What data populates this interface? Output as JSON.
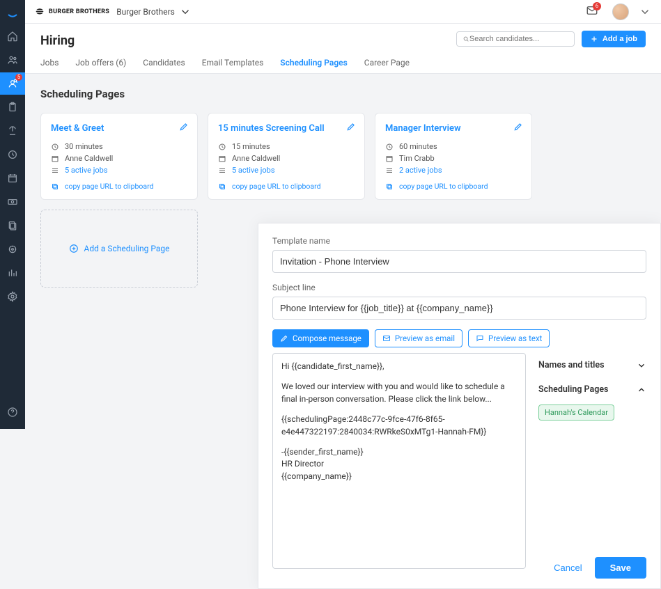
{
  "brand": {
    "logo_text": "BURGER BROTHERS",
    "company_name": "Burger Brothers"
  },
  "topbar": {
    "mail_count": "6"
  },
  "leftnav": {
    "badge": "5"
  },
  "hiring": {
    "title": "Hiring",
    "search_placeholder": "Search candidates...",
    "add_job_label": "Add a job"
  },
  "tabs": [
    {
      "label": "Jobs"
    },
    {
      "label": "Job offers (6)"
    },
    {
      "label": "Candidates"
    },
    {
      "label": "Email Templates"
    },
    {
      "label": "Scheduling Pages"
    },
    {
      "label": "Career Page"
    }
  ],
  "page": {
    "heading": "Scheduling Pages",
    "cards": [
      {
        "title": "Meet & Greet",
        "duration": "30 minutes",
        "owner": "Anne Caldwell",
        "active": "5 active jobs",
        "copy": "copy page URL to clipboard"
      },
      {
        "title": "15 minutes Screening Call",
        "duration": "15 minutes",
        "owner": "Anne Caldwell",
        "active": "5 active jobs",
        "copy": "copy page URL to clipboard"
      },
      {
        "title": "Manager Interview",
        "duration": "60 minutes",
        "owner": "Tim Crabb",
        "active": "2 active jobs",
        "copy": "copy page URL to clipboard"
      }
    ],
    "add_card_label": "Add a Scheduling Page"
  },
  "modal": {
    "template_name_label": "Template name",
    "template_name_value": "Invitation - Phone Interview",
    "subject_label": "Subject line",
    "subject_value": "Phone Interview for {{job_title}} at {{company_name}}",
    "pills": {
      "compose": "Compose message",
      "preview_email": "Preview as email",
      "preview_text": "Preview as text"
    },
    "body_lines": {
      "l1": "Hi {{candidate_first_name}},",
      "l2": "We loved our interview with you and would like to schedule a final in-person conversation. Please click the link below...",
      "l3": "{{schedulingPage:2448c77c-9fce-47f6-8f65-e4e447322197:2840034:RWRkeS0xMTg1-Hannah-FM}}",
      "l4": "-{{sender_first_name}}",
      "l5": "HR Director",
      "l6": "{{company_name}}"
    },
    "side": {
      "group1": "Names and titles",
      "group2": "Scheduling Pages",
      "chip": "Hannah's Calendar"
    },
    "footer": {
      "cancel": "Cancel",
      "save": "Save"
    }
  }
}
